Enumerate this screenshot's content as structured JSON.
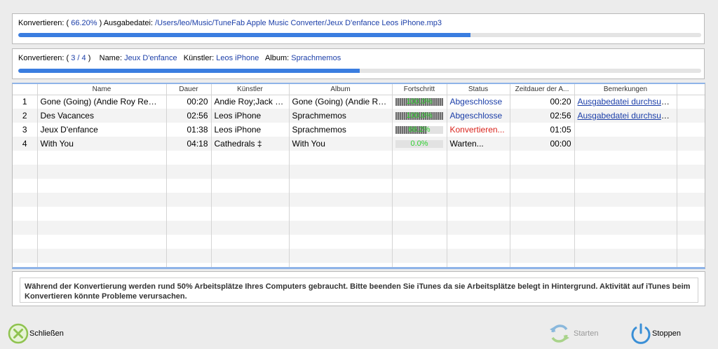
{
  "overall": {
    "prefix": "Konvertieren: (",
    "percent": "66.20%",
    "suffix": ")",
    "output_label": "Ausgabedatei:",
    "output_path": "/Users/leo/Music/TuneFab Apple Music Converter/Jeux D'enfance Leos iPhone.mp3",
    "progress": 0.662
  },
  "current": {
    "prefix": "Konvertieren: (",
    "index": "3",
    "sep": "/",
    "total": "4",
    "suffix": ")",
    "name_label": "Name:",
    "name": "Jeux D'enfance",
    "artist_label": "Künstler:",
    "artist": "Leos iPhone",
    "album_label": "Album:",
    "album": "Sprachmemos",
    "progress": 0.5
  },
  "table": {
    "headers": [
      "",
      "Name",
      "Dauer",
      "Künstler",
      "Album",
      "Fortschritt",
      "Status",
      "Zeitdauer der A...",
      "Bemerkungen"
    ],
    "rows": [
      {
        "num": "1",
        "name": "Gone (Going) (Andie Roy Remix)",
        "duration": "00:20",
        "artist": "Andie Roy;Jack J...",
        "album": "Gone (Going) (Andie Ro...",
        "progress_label": "100.0%",
        "progress": 1.0,
        "status": "Abgeschlosse",
        "status_type": "done",
        "time": "00:20",
        "remark": "Ausgabedatei durchsuchen"
      },
      {
        "num": "2",
        "name": "Des Vacances",
        "duration": "02:56",
        "artist": "Leos iPhone",
        "album": "Sprachmemos",
        "progress_label": "100.0%",
        "progress": 1.0,
        "status": "Abgeschlosse",
        "status_type": "done",
        "time": "02:56",
        "remark": "Ausgabedatei durchsuchen"
      },
      {
        "num": "3",
        "name": "Jeux D'enfance",
        "duration": "01:38",
        "artist": "Leos iPhone",
        "album": "Sprachmemos",
        "progress_label": "66.2%",
        "progress": 0.662,
        "status": "Konvertieren...",
        "status_type": "active",
        "time": "01:05",
        "remark": ""
      },
      {
        "num": "4",
        "name": "With You",
        "duration": "04:18",
        "artist": "Cathedrals ‡",
        "album": "With You",
        "progress_label": "0.0%",
        "progress": 0.0,
        "status": "Warten...",
        "status_type": "waiting",
        "time": "00:00",
        "remark": ""
      }
    ],
    "empty_rows": 9
  },
  "note": "Während der Konvertierung werden rund 50% Arbeitsplätze Ihres Computers gebraucht. Bitte beenden Sie iTunes da sie Arbeitsplätze belegt in Hintergrund. Aktivität auf iTunes beim Konvertieren könnte Probleme verursachen.",
  "buttons": {
    "close": "Schließen",
    "start": "Starten",
    "stop": "Stoppen"
  },
  "icons": {
    "close": "close-x-circle-icon",
    "start": "refresh-arrows-icon",
    "stop": "power-icon"
  },
  "colors": {
    "progress": "#3a7de0",
    "link": "#1b3ea8",
    "active_status": "#d9241c",
    "bar_label": "#2fd12f"
  }
}
